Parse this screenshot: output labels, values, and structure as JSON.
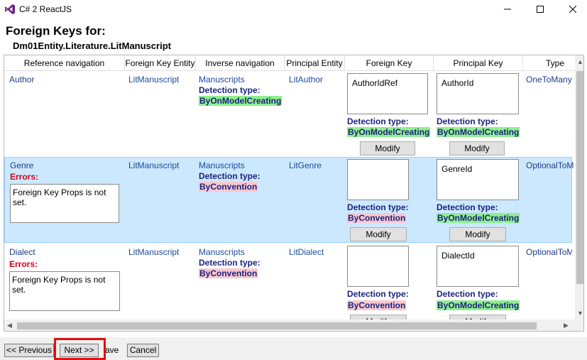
{
  "window": {
    "title": "C# 2 ReactJS"
  },
  "header": {
    "title": "Foreign Keys for:",
    "entity": "Dm01Entity.Literature.LitManuscript"
  },
  "columns": [
    "Reference navigation",
    "Foreign Key Entity",
    "Inverse navigation",
    "Principal Entity",
    "Foreign Key",
    "Principal Key",
    "Type"
  ],
  "labels": {
    "detection": "Detection type:",
    "errors": "Errors:",
    "modify": "Modify"
  },
  "rows": [
    {
      "ref_nav": "Author",
      "fk_entity": "LitManuscript",
      "inverse_nav": "Manuscripts",
      "inverse_detection": "ByOnModelCreating",
      "principal_entity": "LitAuthor",
      "fk_value": "AuthorIdRef",
      "fk_detection": "ByOnModelCreating",
      "pk_value": "AuthorId",
      "pk_detection": "ByOnModelCreating",
      "type": "OneToMany"
    },
    {
      "ref_nav": "Genre",
      "error_text": "Foreign Key Props is not set.",
      "fk_entity": "LitManuscript",
      "inverse_nav": "Manuscripts",
      "inverse_detection": "ByConvention",
      "principal_entity": "LitGenre",
      "fk_value": "",
      "fk_detection": "ByConvention",
      "pk_value": "GenreId",
      "pk_detection": "ByOnModelCreating",
      "type": "OptionalToM"
    },
    {
      "ref_nav": "Dialect",
      "error_text": "Foreign Key Props is not set.",
      "fk_entity": "LitManuscript",
      "inverse_nav": "Manuscripts",
      "inverse_detection": "ByConvention",
      "principal_entity": "LitDialect",
      "fk_value": "",
      "fk_detection": "ByConvention",
      "pk_value": "DialectId",
      "pk_detection": "ByOnModelCreating",
      "type": "OptionalToM"
    }
  ],
  "buttons": {
    "previous": "<< Previous",
    "next": "Next >>",
    "save": "ave",
    "cancel": "Cancel"
  },
  "colors": {
    "highlight": "#e01010",
    "selected_row": "#cce8ff",
    "green_tag": "#90ee90",
    "pink_tag": "#f8c8d0"
  },
  "icons": [
    "visual-studio-icon",
    "minimize-icon",
    "maximize-icon",
    "close-icon",
    "scroll-left-icon",
    "scroll-right-icon",
    "scroll-up-icon",
    "scroll-down-icon"
  ]
}
